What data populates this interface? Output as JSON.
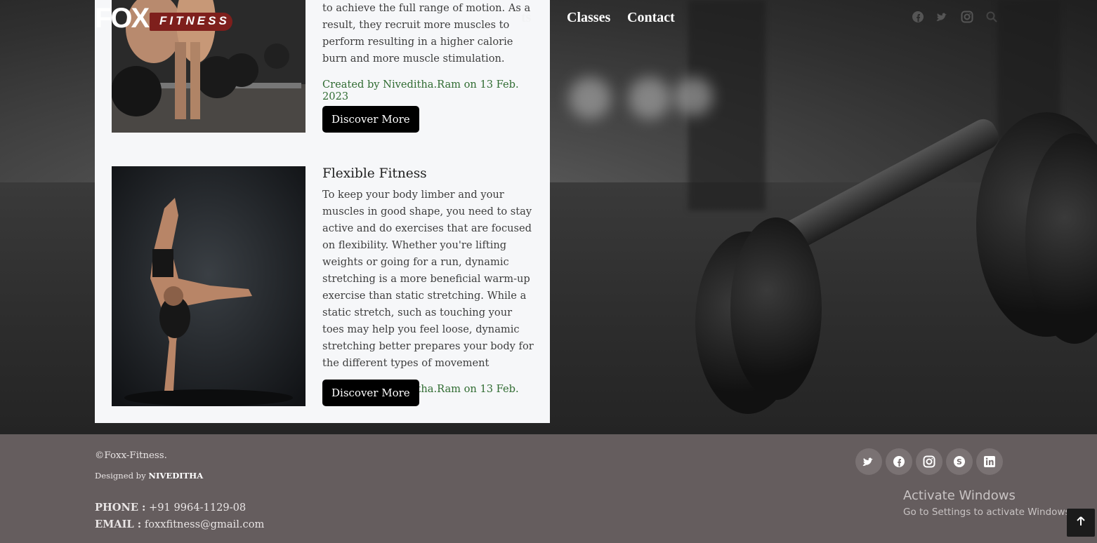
{
  "nav": {
    "logo_letters": "FOX",
    "logo_word": "FITNESS",
    "links": [
      {
        "label": "Classes"
      },
      {
        "label": "Contact"
      }
    ],
    "partial_link": "ts",
    "icons": [
      "facebook-icon",
      "twitter-icon",
      "instagram-icon",
      "search-icon"
    ]
  },
  "posts": [
    {
      "body_tail": "to achieve the full range of motion. As a result, they recruit more muscles to perform resulting in a higher calorie burn and more muscle stimulation.",
      "meta": "Created by Niveditha.Ram on 13 Feb. 2023",
      "button": "Discover More"
    },
    {
      "title": "Flexible Fitness",
      "body": "To keep your body limber and your muscles in good shape, you need to stay active and do exercises that are focused on flexibility. Whether you're lifting weights or going for a run, dynamic stretching is a more beneficial warm-up exercise than static stretching. While a static stretch, such as touching your toes may help you feel loose, dynamic stretching better prepares your body for the different types of movement",
      "meta": "Created by Niveditha.Ram on 13 Feb. 2023",
      "button": "Discover More"
    }
  ],
  "footer": {
    "copyright": "©Foxx-Fitness.",
    "designed_prefix": "Designed by",
    "designer": "NIVEDITHA",
    "phone_label": "PHONE :",
    "phone": "+91 9964-1129-08",
    "email_label": "EMAIL :",
    "email": "foxxfitness@gmail.com",
    "social": [
      "twitter-icon",
      "facebook-icon",
      "instagram-icon",
      "skype-icon",
      "linkedin-icon"
    ],
    "windows_title": "Activate Windows",
    "windows_sub": "Go to Settings to activate Windows."
  },
  "colors": {
    "card_bg": "#f6f7f9",
    "meta_green": "#2f6b31",
    "button_bg": "#000000",
    "footer_bg": "#655d5e",
    "logo_red": "#7e1f1c"
  }
}
